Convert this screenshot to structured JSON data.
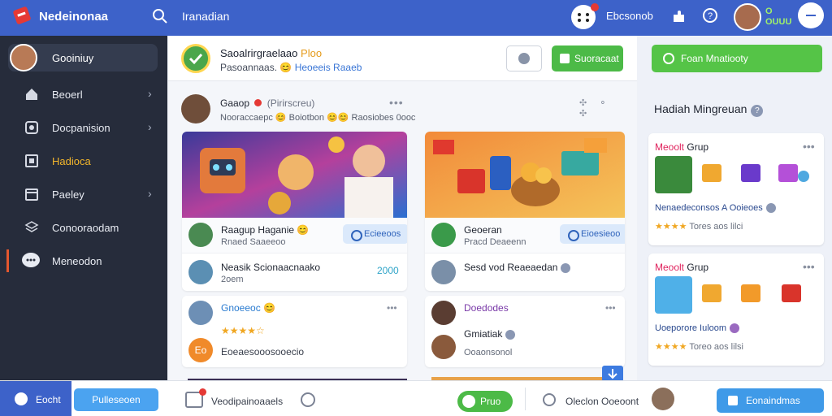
{
  "topbar": {
    "app_name": "Nedeinonaa",
    "search_text": "Iranadian",
    "label": "Ebcsonob",
    "coins_top": "O",
    "coins_bottom": "OUUU"
  },
  "sidebar": {
    "profile_name": "Gooiniuy",
    "items": [
      {
        "label": "Beoerl",
        "icon": "home-icon"
      },
      {
        "label": "Docpanision",
        "icon": "camera-icon"
      },
      {
        "label": "Hadioca",
        "icon": "box-icon"
      },
      {
        "label": "Paeley",
        "icon": "calendar-icon"
      },
      {
        "label": "Conooraodam",
        "icon": "layers-icon"
      },
      {
        "label": "Meneodon",
        "icon": "chat-icon"
      }
    ]
  },
  "feed": {
    "header_title": "Saoalrirgraelaao",
    "header_title_hl": "Ploo",
    "header_sub": "Pasoannaas. 😊",
    "header_sub_blue": "Heoeeis Raaeb",
    "support_label": "Suoracaat",
    "post_name": "Gaaop",
    "post_name_tag": "(Pirirscreu)",
    "post_sub": "Nooraccaepc 😊 Boiotbon 😊😊 Raosiobes 0ooc",
    "post_dots": "•••",
    "post_icons": "✣ ⚬ ✣"
  },
  "cards": {
    "c1_row1_t1": "Raagup Haganie 😊",
    "c1_row1_t2": "Rnaed Saaeeoo",
    "c1_row1_pill": "Ecieeoos",
    "c1_row2_t1": "Neasik Scionaacnaako",
    "c1_row2_t2": "2oem",
    "c1_row2_num": "2000",
    "c2_row1_t1": "Geoeran",
    "c2_row1_t2": "Pracd Deaeenn",
    "c2_row1_pill": "Eioesieoo",
    "c2_row2_t1": "Sesd vod Reaeaedan",
    "c3_t1": "Gnoeeoc 😊",
    "c3_stars": "★★★★☆",
    "c3_t2": "Eoeaesooosooecio",
    "c4_t1": "Doedodes",
    "c4_t2": "Gmiatiak",
    "c4_t3": "Ooaonsonol",
    "dots": "•••"
  },
  "right": {
    "button_label": "Foan Mnatiooty",
    "heading": "Hadiah Mingreuan",
    "card1": {
      "title_accent": "Meoolt",
      "title": "Grup",
      "line1": "Nenaedeconsos A Ooieoes",
      "stars": "★★★★",
      "stars_text": "Tores aos lilci"
    },
    "card2": {
      "title_accent": "Meoolt",
      "title": "Grup",
      "line1": "Uoeporore Iuloom",
      "stars": "★★★★",
      "stars_text": "Toreo aos lilsi"
    }
  },
  "bottombar": {
    "left_label": "Eocht",
    "blue_button": "Pulleseoen",
    "text1": "Veodipainoaaels",
    "green_button": "Pruo",
    "text2": "Oleclon Ooeoont",
    "action_button": "Eonaindmas"
  },
  "colors": {
    "primary": "#3d62c9",
    "sidebar_bg": "#262c3b",
    "green": "#4cba47",
    "accent_orange": "#f3b62c",
    "accent_red": "#e4572e"
  }
}
